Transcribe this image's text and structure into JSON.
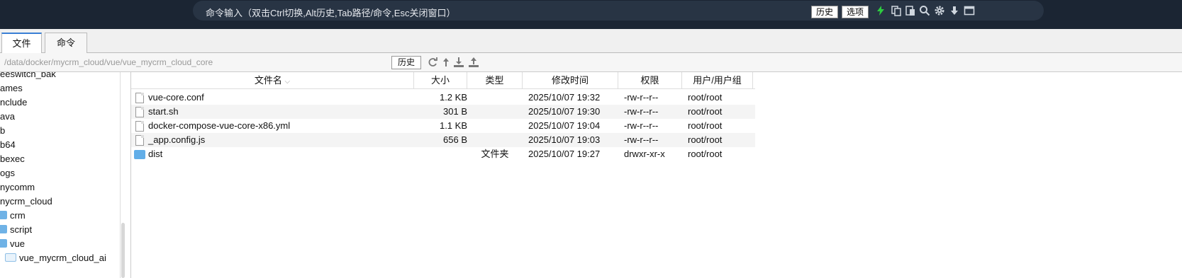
{
  "command_bar": {
    "placeholder": "命令输入（双击Ctrl切换,Alt历史,Tab路径/命令,Esc关闭窗口）",
    "history_label": "历史",
    "options_label": "选项",
    "icons": [
      "lightning-icon",
      "copy-icon",
      "paste-icon",
      "search-icon",
      "gear-icon",
      "arrow-down-icon",
      "window-icon"
    ]
  },
  "tabs": [
    {
      "label": "文件",
      "active": true
    },
    {
      "label": "命令",
      "active": false
    }
  ],
  "path_bar": {
    "path": "/data/docker/mycrm_cloud/vue/vue_mycrm_cloud_core",
    "history_label": "历史",
    "icons": [
      "refresh-icon",
      "up-icon",
      "download-icon",
      "upload-icon"
    ]
  },
  "tree": {
    "items": [
      {
        "label": "eeswitch_bak",
        "folder": false
      },
      {
        "label": "ames",
        "folder": false
      },
      {
        "label": "nclude",
        "folder": false
      },
      {
        "label": "ava",
        "folder": false
      },
      {
        "label": "b",
        "folder": false
      },
      {
        "label": "b64",
        "folder": false
      },
      {
        "label": "bexec",
        "folder": false
      },
      {
        "label": "ogs",
        "folder": false
      },
      {
        "label": "nycomm",
        "folder": false
      },
      {
        "label": "nycrm_cloud",
        "folder": false
      },
      {
        "label": "crm",
        "folder": true
      },
      {
        "label": "script",
        "folder": true
      },
      {
        "label": "vue",
        "folder": true
      },
      {
        "label": "vue_mycrm_cloud_ai",
        "folder": true,
        "open": true
      }
    ]
  },
  "file_table": {
    "columns": [
      "文件名",
      "大小",
      "类型",
      "修改时间",
      "权限",
      "用户/用户组"
    ],
    "rows": [
      {
        "name": "vue-core.conf",
        "size": "1.2 KB",
        "type": "",
        "mtime": "2025/10/07 19:32",
        "perm": "-rw-r--r--",
        "owner": "root/root",
        "is_dir": false
      },
      {
        "name": "start.sh",
        "size": "301 B",
        "type": "",
        "mtime": "2025/10/07 19:30",
        "perm": "-rw-r--r--",
        "owner": "root/root",
        "is_dir": false
      },
      {
        "name": "docker-compose-vue-core-x86.yml",
        "size": "1.1 KB",
        "type": "",
        "mtime": "2025/10/07 19:04",
        "perm": "-rw-r--r--",
        "owner": "root/root",
        "is_dir": false
      },
      {
        "name": "_app.config.js",
        "size": "656 B",
        "type": "",
        "mtime": "2025/10/07 19:03",
        "perm": "-rw-r--r--",
        "owner": "root/root",
        "is_dir": false
      },
      {
        "name": "dist",
        "size": "",
        "type": "文件夹",
        "mtime": "2025/10/07 19:27",
        "perm": "drwxr-xr-x",
        "owner": "root/root",
        "is_dir": true
      }
    ]
  },
  "colors": {
    "topbar": "#1b2533",
    "accent": "#3a7fd5",
    "lightning": "#2ecc40",
    "folder": "#62aee8"
  }
}
